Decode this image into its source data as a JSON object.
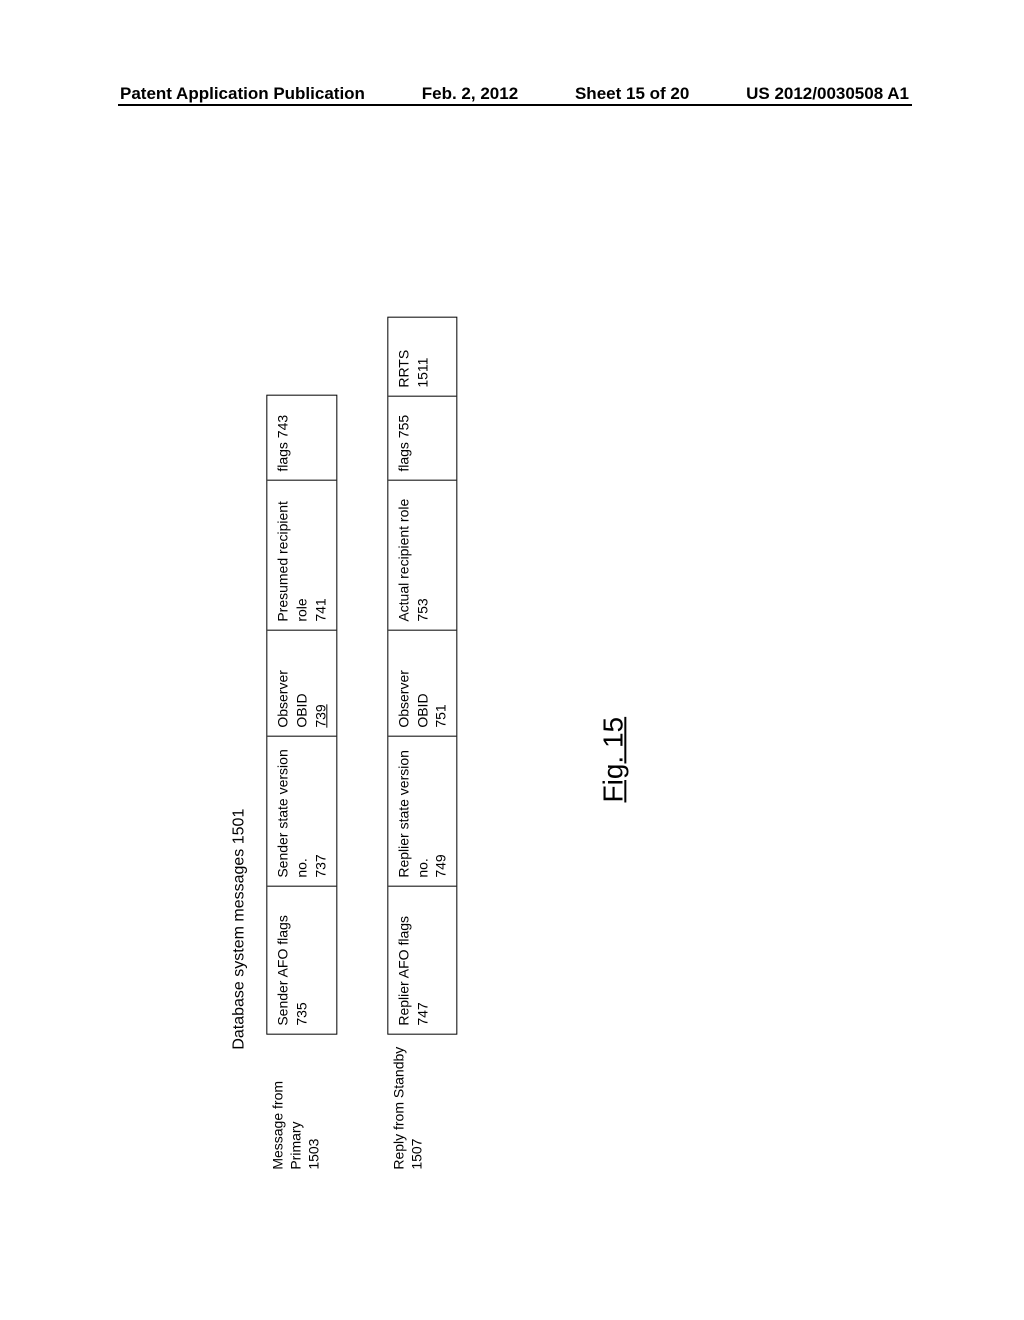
{
  "header": {
    "publication": "Patent Application Publication",
    "date": "Feb. 2, 2012",
    "sheet": "Sheet 15 of 20",
    "patno": "US 2012/0030508 A1"
  },
  "diagram": {
    "title": "Database system messages 1501",
    "row1": {
      "label_l1": "Message from Primary",
      "label_l2": "1503",
      "afo": "Sender AFO flags 735",
      "ver_l1": "Sender state version no.",
      "ver_l2": "737",
      "obid_l1": "Observer OBID",
      "obid_l2": "739",
      "role_l1": "Presumed recipient role",
      "role_l2": "741",
      "flags": "flags 743"
    },
    "row2": {
      "label_l1": "Reply from Standby",
      "label_l2": "1507",
      "afo": "Replier AFO flags 747",
      "ver_l1": "Replier state version no.",
      "ver_l2": "749",
      "obid_l1": "Observer OBID",
      "obid_l2": "751",
      "role_l1": "Actual recipient role",
      "role_l2": "753",
      "flags": "flags 755",
      "rrts": "RRTS 1511"
    },
    "figlabel": "Fig. 15"
  }
}
